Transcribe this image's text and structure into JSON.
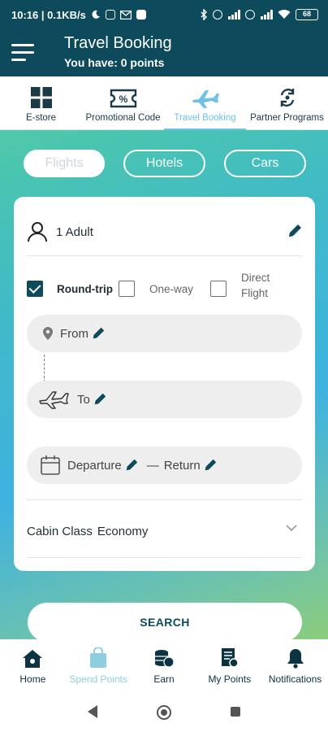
{
  "status_bar": {
    "time_speed": "10:16 | 0.1KB/s",
    "battery": "68"
  },
  "header": {
    "title": "Travel Booking",
    "points": "You have: 0 points"
  },
  "top_tabs": [
    {
      "label": "E-store",
      "icon": "grid-icon"
    },
    {
      "label": "Promotional Code",
      "icon": "coupon-icon"
    },
    {
      "label": "Travel Booking",
      "icon": "airplane-icon",
      "active": true
    },
    {
      "label": "Partner Programs",
      "icon": "exchange-icon"
    }
  ],
  "segments": {
    "flights": "Flights",
    "hotels": "Hotels",
    "cars": "Cars",
    "active": "Flights"
  },
  "form": {
    "passengers": "1 Adult",
    "trip_options": {
      "round_trip": "Round-trip",
      "one_way": "One-way",
      "direct_line1": "Direct",
      "direct_line2": "Flight",
      "round_trip_checked": true,
      "one_way_checked": false,
      "direct_checked": false
    },
    "from_label": "From",
    "to_label": "To",
    "departure_label": "Departure",
    "separator": "—",
    "return_label": "Return",
    "cabin_label": "Cabin Class",
    "cabin_value": "Economy"
  },
  "search_label": "SEARCH",
  "bottom_nav": [
    {
      "label": "Home",
      "icon": "home-icon"
    },
    {
      "label": "Spend Points",
      "icon": "shopping-bag-icon",
      "active": true
    },
    {
      "label": "Earn",
      "icon": "coins-icon"
    },
    {
      "label": "My Points",
      "icon": "receipt-icon"
    },
    {
      "label": "Notifications",
      "icon": "bell-icon"
    }
  ],
  "colors": {
    "primary": "#0c4a5c",
    "active_tab": "#6ec3e5",
    "gradient_start": "#4ec9a8",
    "gradient_mid": "#3fb2e0",
    "gradient_end": "#8bcc7c"
  }
}
